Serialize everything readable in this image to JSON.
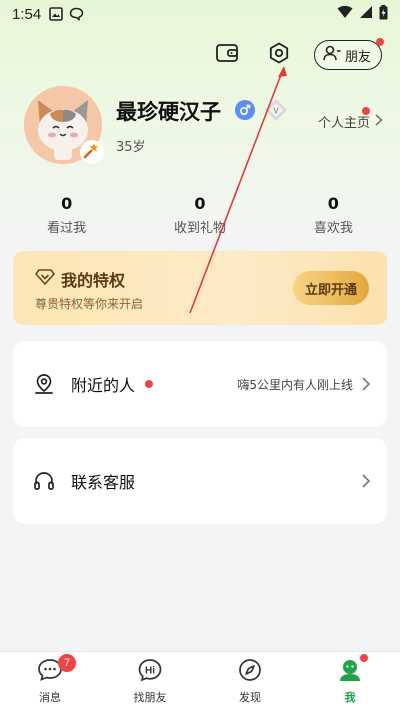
{
  "status_bar": {
    "time": "1:54"
  },
  "header": {
    "friends_label": "朋友"
  },
  "profile": {
    "name": "最珍硬汉子",
    "age": "35岁",
    "home_link": "个人主页"
  },
  "stats": [
    {
      "value": "0",
      "label": "看过我"
    },
    {
      "value": "0",
      "label": "收到礼物"
    },
    {
      "value": "0",
      "label": "喜欢我"
    }
  ],
  "privilege": {
    "title": "我的特权",
    "subtitle": "尊贵特权等你来开启",
    "button": "立即开通"
  },
  "nearby": {
    "title": "附近的人",
    "description": "嗨5公里内有人刚上线"
  },
  "service": {
    "title": "联系客服"
  },
  "tabbar": {
    "tabs": [
      {
        "label": "消息",
        "badge": "7"
      },
      {
        "label": "找朋友"
      },
      {
        "label": "发现"
      },
      {
        "label": "我"
      }
    ]
  },
  "colors": {
    "accent": "#1fa447",
    "badge_red": "#f04444",
    "gold": "#e4a83a"
  }
}
